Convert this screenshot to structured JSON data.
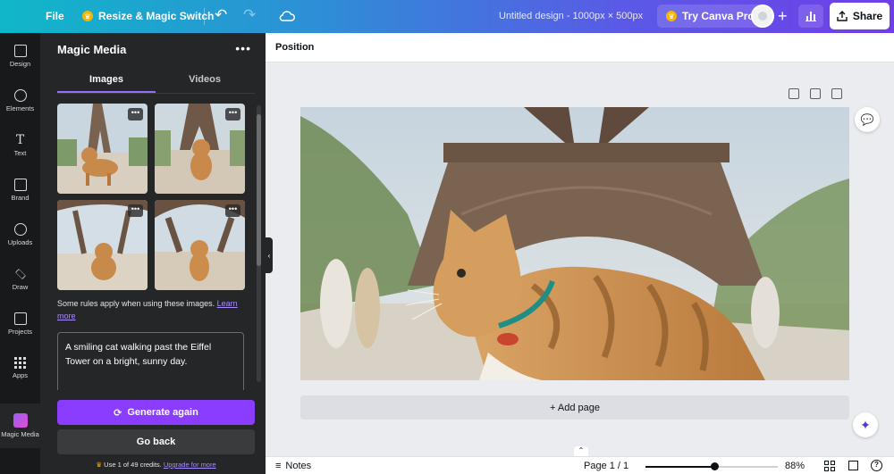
{
  "topbar": {
    "file_label": "File",
    "resize_label": "Resize & Magic Switch",
    "title": "Untitled design - 1000px × 500px",
    "try_pro_label": "Try Canva Pro",
    "share_label": "Share"
  },
  "rail": {
    "items": [
      {
        "label": "Design",
        "icon": "layout-icon"
      },
      {
        "label": "Elements",
        "icon": "shapes-icon"
      },
      {
        "label": "Text",
        "icon": "text-icon"
      },
      {
        "label": "Brand",
        "icon": "brand-icon"
      },
      {
        "label": "Uploads",
        "icon": "upload-icon"
      },
      {
        "label": "Draw",
        "icon": "draw-icon"
      },
      {
        "label": "Projects",
        "icon": "folder-icon"
      },
      {
        "label": "Apps",
        "icon": "apps-icon"
      },
      {
        "label": "Magic Media",
        "icon": "magic-media-icon"
      }
    ]
  },
  "panel": {
    "title": "Magic Media",
    "tabs": [
      {
        "label": "Images"
      },
      {
        "label": "Videos"
      }
    ],
    "rules_text": "Some rules apply when using these images.",
    "rules_link": "Learn more",
    "prompt": "A smiling cat walking past the Eiffel Tower on a bright, sunny day.",
    "generate_label": "Generate again",
    "back_label": "Go back",
    "credits_text": "Use 1 of 49 credits.",
    "credits_link": "Upgrade for more"
  },
  "canvas": {
    "position_label": "Position",
    "add_page_label": "+ Add page"
  },
  "bottombar": {
    "notes_label": "Notes",
    "page_label": "Page 1 / 1",
    "zoom_label": "88%",
    "zoom_fraction": 0.88
  },
  "colors": {
    "accent": "#8b3dff",
    "topbar_start": "#10b7c9",
    "topbar_end": "#6f3ee8",
    "panel_bg": "#252627",
    "rail_bg": "#18191b"
  }
}
